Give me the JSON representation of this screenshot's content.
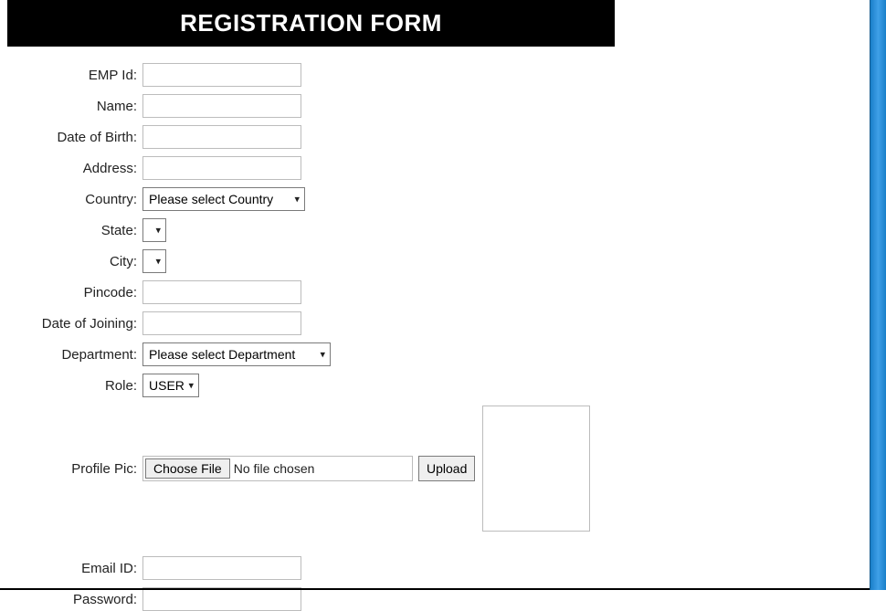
{
  "header": {
    "title": "REGISTRATION FORM"
  },
  "form": {
    "empId": {
      "label": "EMP Id:",
      "value": ""
    },
    "name": {
      "label": "Name:",
      "value": ""
    },
    "dob": {
      "label": "Date of Birth:",
      "value": ""
    },
    "address": {
      "label": "Address:",
      "value": ""
    },
    "country": {
      "label": "Country:",
      "selected": "Please select Country"
    },
    "state": {
      "label": "State:",
      "selected": ""
    },
    "city": {
      "label": "City:",
      "selected": ""
    },
    "pincode": {
      "label": "Pincode:",
      "value": ""
    },
    "doj": {
      "label": "Date of Joining:",
      "value": ""
    },
    "department": {
      "label": "Department:",
      "selected": "Please select Department"
    },
    "role": {
      "label": "Role:",
      "selected": "USER"
    },
    "profilePic": {
      "label": "Profile Pic:",
      "chooseFile": "Choose File",
      "noFile": "No file chosen",
      "upload": "Upload"
    },
    "emailId": {
      "label": "Email ID:",
      "value": ""
    },
    "password": {
      "label": "Password:",
      "value": ""
    }
  }
}
